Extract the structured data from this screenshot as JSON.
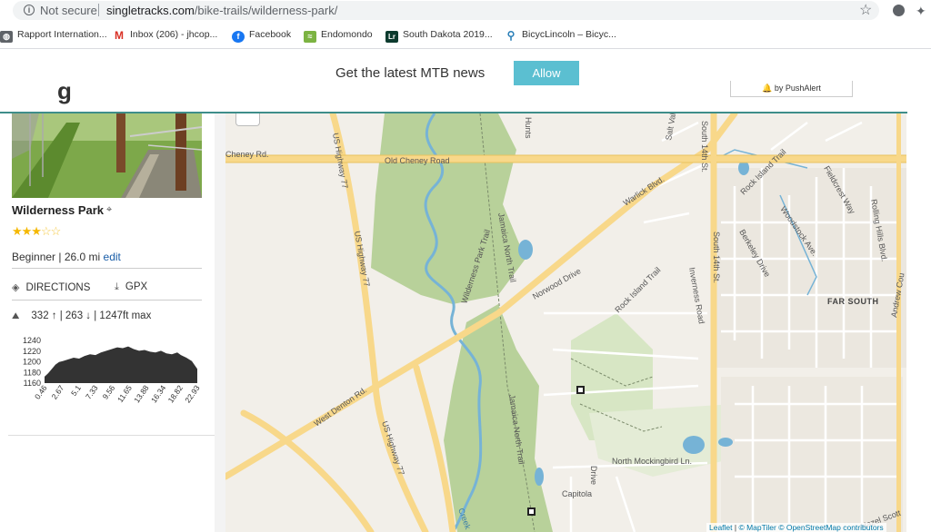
{
  "browser": {
    "security_label": "Not secure",
    "url_host": "singletracks.com",
    "url_path": "/bike-trails/wilderness-park/",
    "icons": [
      "info-icon",
      "bookmark-star-icon",
      "extension-icon",
      "puzzle-icon"
    ]
  },
  "bookmarks": [
    {
      "label": "Rapport Internation...",
      "icon": "globe-icon",
      "color": "#5f6368"
    },
    {
      "label": "Inbox (206) - jhcop...",
      "icon": "gmail-icon",
      "color": "#d93025"
    },
    {
      "label": "Facebook",
      "icon": "facebook-icon",
      "color": "#1877f2"
    },
    {
      "label": "Endomondo",
      "icon": "endomondo-icon",
      "color": "#7cb342"
    },
    {
      "label": "South Dakota 2019...",
      "icon": "lr-icon",
      "color": "#0d3b2e"
    },
    {
      "label": "BicycLincoln – Bicyc...",
      "icon": "bike-icon",
      "color": "#2a7fb8"
    }
  ],
  "push_alert": {
    "message": "Get the latest MTB news",
    "allow_label": "Allow",
    "brand": "by PushAlert"
  },
  "trail": {
    "name": "Wilderness Park",
    "rating": 3,
    "rating_max": 5,
    "difficulty": "Beginner | 26.0 mi",
    "edit_label": "edit",
    "directions_label": "DIRECTIONS",
    "gpx_label": "GPX",
    "elevation_summary": "332 ↑ | 263 ↓ | 1247ft max"
  },
  "elevation_chart": {
    "y_ticks": [
      "1240",
      "1220",
      "1200",
      "1180",
      "1160"
    ],
    "x_ticks": [
      "0.46",
      "2.67",
      "5.1",
      "7.33",
      "9.56",
      "11.65",
      "13.88",
      "16.34",
      "18.82",
      "22.93"
    ],
    "fill_color": "#333333"
  },
  "map": {
    "labels": {
      "old_cheney_road": "Old Cheney Road",
      "cheney_rd": "Cheney Rd.",
      "us_highway_77_a": "US Highway 77",
      "us_highway_77_b": "US Highway 77",
      "us_highway_77_c": "US Highway 77",
      "warlick_blvd": "Warlick Blvd.",
      "south_14th_st_a": "South 14th St.",
      "south_14th_st_b": "South 14th St.",
      "rock_island_trail_a": "Rock Island Trail",
      "rock_island_trail_b": "Rock Island Trail",
      "norwood_drive": "Norwood Drive",
      "inverness_road": "Inverness Road",
      "berkeley_drive": "Berkeley Drive",
      "woodstock_ave": "Woodstock Ave.",
      "fieldcrest_way": "Fieldcrest Way",
      "rolling_hills_blvd": "Rolling Hills Blvd.",
      "far_south": "FAR SOUTH",
      "andrew_ct": "Andrew Cou",
      "jamaica_north_trail_a": "Jamaica North Trail",
      "jamaica_north_trail_b": "Jamaica North Trail",
      "wilderness_park_trail": "Wilderness Park Trail",
      "west_denton_rd": "West Denton Rd.",
      "north_mockingbird": "North Mockingbird Ln.",
      "capitola": "Capitola",
      "drive": "Drive",
      "huntington": "Hunts",
      "salt_valley": "Salt Vall",
      "hazel_scott": "Hazel Scott",
      "salt_creek": "Creek"
    },
    "attribution": {
      "leaflet": "Leaflet",
      "maptiler": "© MapTiler",
      "osm": "© OpenStreetMap contributors",
      "separator": " | "
    }
  },
  "colors": {
    "accent": "#5bbfd1",
    "teal_rule": "#3e8e8a",
    "park_green": "#b8d19a",
    "water": "#76b3d6",
    "road_major": "#f8d88a",
    "link": "#1a5ea8"
  }
}
